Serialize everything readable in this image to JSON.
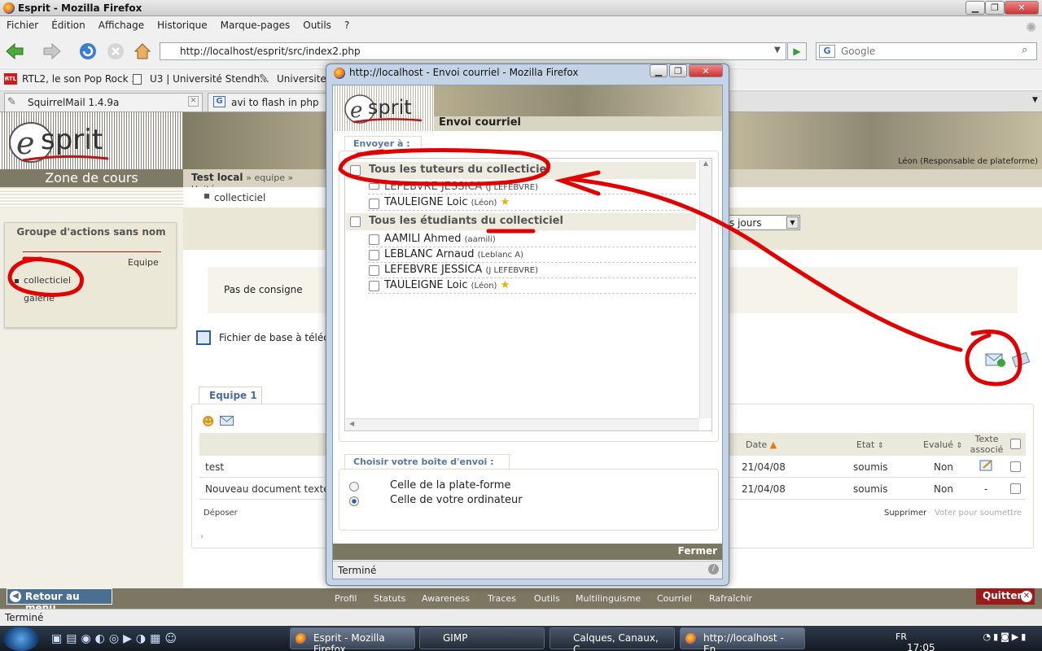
{
  "window": {
    "title": "Esprit - Mozilla Firefox"
  },
  "menu": [
    "Fichier",
    "Édition",
    "Affichage",
    "Historique",
    "Marque-pages",
    "Outils",
    "?"
  ],
  "nav": {
    "url": "http://localhost/esprit/src/index2.php",
    "search_placeholder": "Google"
  },
  "bookmarks": [
    "RTL2, le son Pop Rock ...",
    "U3 | Université Stendh...",
    "Universite S"
  ],
  "tabs": [
    "SquirrelMail 1.4.9a",
    "avi to flash in php apac"
  ],
  "page": {
    "zone": "Zone de cours",
    "breadcrumb_bold": "Test local",
    "breadcrumb_rest": "» equipe » Unité",
    "bullet_link": "collecticiel",
    "group_title": "Groupe d'actions sans nom",
    "equipe_label": "Equipe",
    "left_links": [
      "collecticiel",
      "galerie"
    ],
    "banner_user": "Léon (Responsable de plateforme)",
    "consigne": "Pas de consigne",
    "fichier": "Fichier de base à téléch",
    "duration_select": "s jours",
    "tab_equipe": "Equipe 1",
    "table_headers": {
      "date": "Date",
      "etat": "Etat",
      "evalue": "Evalué",
      "texte": "Texte associé"
    },
    "rows": [
      {
        "name": "test",
        "date": "21/04/08",
        "etat": "soumis",
        "evalue": "Non",
        "texte": ""
      },
      {
        "name": "Nouveau document texte.",
        "date": "21/04/08",
        "etat": "soumis",
        "evalue": "Non",
        "texte": "-"
      }
    ],
    "deposer": "Déposer",
    "supprimer": "Supprimer",
    "voter": "Voter pour soumettre",
    "more": "›"
  },
  "footer": {
    "retour": "Retour au menu",
    "nav": [
      "Profil",
      "Statuts",
      "Awareness",
      "Traces",
      "Outils",
      "Multilinguisme",
      "Courriel",
      "Rafraîchir"
    ],
    "quitter": "Quitter",
    "status": "Terminé"
  },
  "dialog": {
    "title": "http://localhost - Envoi courriel - Mozilla Firefox",
    "subtitle": "Envoi courriel",
    "send_to": "Envoyer à :",
    "group_tutors": "Tous les tuteurs du collecticiel",
    "tutors": [
      {
        "name": "LEFEBVRE JESSICA",
        "login": "(J LEFEBVRE)"
      },
      {
        "name": "TAULEIGNE Loic",
        "login": "(Léon)"
      }
    ],
    "group_students": "Tous les étudiants du collecticiel",
    "students": [
      {
        "name": "AAMILI Ahmed",
        "login": "(aamili)"
      },
      {
        "name": "LEBLANC Arnaud",
        "login": "(Leblanc A)"
      },
      {
        "name": "LEFEBVRE JESSICA",
        "login": "(J LEFEBVRE)"
      },
      {
        "name": "TAULEIGNE Loic",
        "login": "(Léon)"
      }
    ],
    "choose_box": "Choisir votre boîte d'envoi :",
    "options": [
      "Celle de la plate-forme",
      "Celle de votre ordinateur"
    ],
    "close": "Fermer",
    "status": "Terminé"
  },
  "taskbar": {
    "items": [
      "Esprit - Mozilla Firefox",
      "GIMP",
      "Calques, Canaux, C...",
      "http://localhost - En..."
    ],
    "lang": "FR",
    "clock": "17:05"
  },
  "colors": {
    "annotation": "#e00000",
    "footer_bar": "#7c7763",
    "accent_blue": "#4b6f90",
    "quit_red": "#9c1a1a"
  }
}
